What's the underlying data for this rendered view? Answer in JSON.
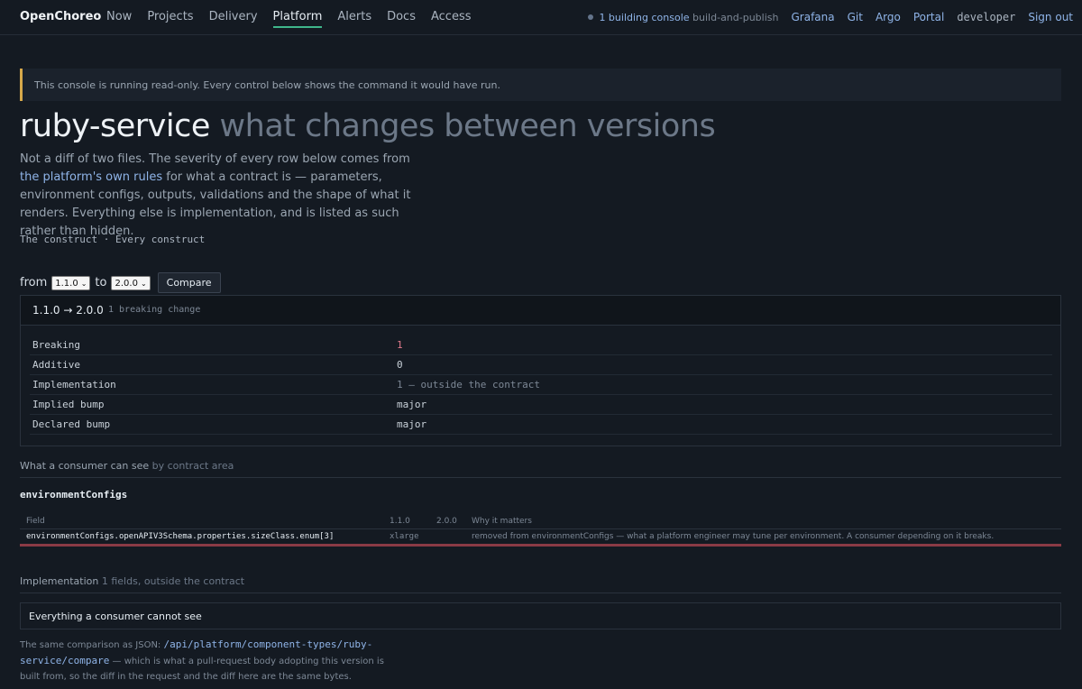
{
  "nav": {
    "brand": "OpenChoreo",
    "links": [
      "Now",
      "Projects",
      "Delivery",
      "Platform",
      "Alerts",
      "Docs",
      "Access"
    ],
    "active": "Platform",
    "status_building": "1 building",
    "status_console": "console",
    "status_job": "build-and-publish",
    "right_links": [
      "Grafana",
      "Git",
      "Argo",
      "Portal"
    ],
    "user": "developer",
    "signout": "Sign out"
  },
  "banner": "This console is running read-only. Every control below shows the command it would have run.",
  "page": {
    "title_main": "ruby-service",
    "title_muted": "what changes between versions",
    "intro_1": "Not a diff of two files. The severity of every row below comes from ",
    "intro_link": "the platform's own rules",
    "intro_2": " for what a contract is — parameters, environment configs, outputs, validations and the shape of what it renders. Everything else is implementation, and is listed as such rather than hidden.",
    "crumb_1": "The construct",
    "crumb_sep": "·",
    "crumb_2": "Every construct"
  },
  "compare": {
    "from_label": "from",
    "from_value": "1.1.0",
    "to_label": "to",
    "to_value": "2.0.0",
    "button": "Compare"
  },
  "summary": {
    "range": "1.1.0 → 2.0.0",
    "breaking_note": "1 breaking change",
    "rows": [
      {
        "k": "Breaking",
        "v": "1"
      },
      {
        "k": "Additive",
        "v": "0"
      },
      {
        "k": "Implementation",
        "v": "1 — outside the contract"
      },
      {
        "k": "Implied bump",
        "v": "major"
      },
      {
        "k": "Declared bump",
        "v": "major"
      }
    ]
  },
  "consumer": {
    "heading": "What a consumer can see",
    "heading_muted": "by contract area",
    "area": "environmentConfigs",
    "cols": [
      "Field",
      "1.1.0",
      "2.0.0",
      "Why it matters"
    ],
    "row": {
      "field": "environmentConfigs.openAPIV3Schema.properties.sizeClass.enum[3]",
      "old": "xlarge",
      "new": "",
      "why": "removed from environmentConfigs — what a platform engineer may tune per environment. A consumer depending on it breaks."
    }
  },
  "implementation": {
    "heading": "Implementation",
    "heading_muted": "1 fields, outside the contract",
    "details": "Everything a consumer cannot see"
  },
  "footer": {
    "prefix": "The same comparison as JSON: ",
    "path": "/api/platform/component-types/ruby-service/compare",
    "suffix": " — which is what a pull-request body adopting this version is built from, so the diff in the request and the diff here are the same bytes."
  }
}
